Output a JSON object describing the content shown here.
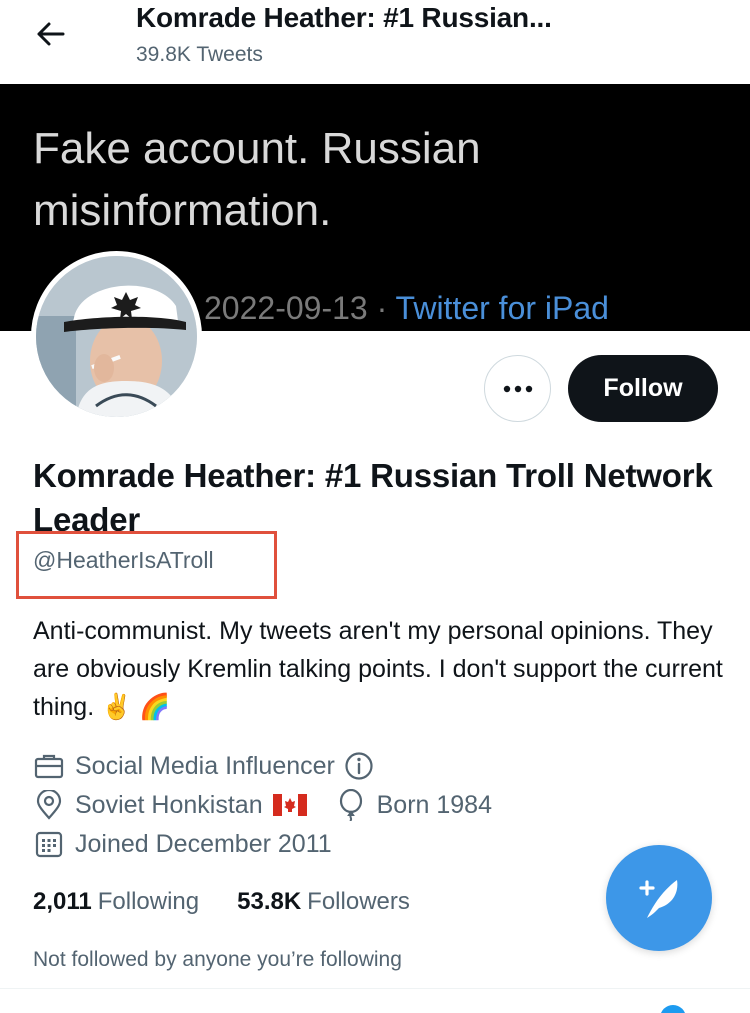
{
  "header": {
    "title": "Komrade Heather: #1 Russian...",
    "tweet_count": "39.8K Tweets"
  },
  "banner": {
    "text_line1": "Fake account. Russian",
    "text_line2": "misinformation.",
    "date": "2022-09-13 · ",
    "source": "Twitter for iPad"
  },
  "profile": {
    "display_name": "Komrade Heather: #1 Russian Troll Network Leader",
    "handle": "@HeatherIsATroll",
    "bio": "Anti-communist. My tweets aren't my personal opinions. They are obviously Kremlin talking points. I don't support the current thing. ✌️ 🌈",
    "category": "Social Media Influencer",
    "location": "Soviet Honkistan",
    "birth": "Born 1984",
    "joined": "Joined December 2011",
    "following_count": "2,011",
    "following_label": "Following",
    "followers_count": "53.8K",
    "followers_label": "Followers",
    "not_followed": "Not followed by anyone you’re following"
  },
  "actions": {
    "follow_label": "Follow"
  },
  "icons": {
    "back": "arrow-left-icon",
    "more": "more-icon",
    "briefcase": "briefcase-icon",
    "info": "info-icon",
    "location": "location-pin-icon",
    "flag": "canada-flag-icon",
    "balloon": "balloon-icon",
    "calendar": "calendar-icon",
    "compose": "compose-tweet-icon"
  },
  "colors": {
    "accent": "#1d9bf0",
    "fab": "#3d97e8",
    "highlight_box": "#e0503c",
    "secondary_text": "#536471"
  }
}
